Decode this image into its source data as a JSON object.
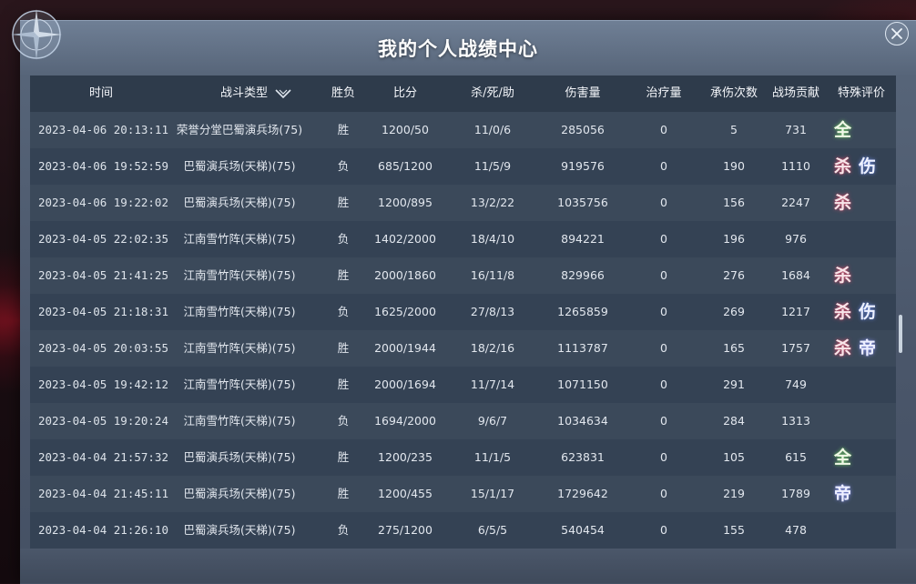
{
  "window": {
    "title": "我的个人战绩中心"
  },
  "table": {
    "headers": {
      "time": "时间",
      "type": "战斗类型",
      "result": "胜负",
      "score": "比分",
      "kda": "杀/死/助",
      "damage": "伤害量",
      "heal": "治疗量",
      "taken": "承伤次数",
      "contrib": "战场贡献",
      "eval": "特殊评价"
    },
    "rows": [
      {
        "time": "2023-04-06 20:13:11",
        "type": "荣誉分堂巴蜀演兵场(75)",
        "result": "胜",
        "score": "1200/50",
        "kda": "11/0/6",
        "damage": "285056",
        "heal": "0",
        "taken": "5",
        "contrib": "731",
        "badges": [
          "全"
        ]
      },
      {
        "time": "2023-04-06 19:52:59",
        "type": "巴蜀演兵场(天梯)(75)",
        "result": "负",
        "score": "685/1200",
        "kda": "11/5/9",
        "damage": "919576",
        "heal": "0",
        "taken": "190",
        "contrib": "1110",
        "badges": [
          "杀",
          "伤"
        ]
      },
      {
        "time": "2023-04-06 19:22:02",
        "type": "巴蜀演兵场(天梯)(75)",
        "result": "胜",
        "score": "1200/895",
        "kda": "13/2/22",
        "damage": "1035756",
        "heal": "0",
        "taken": "156",
        "contrib": "2247",
        "badges": [
          "杀"
        ]
      },
      {
        "time": "2023-04-05 22:02:35",
        "type": "江南雪竹阵(天梯)(75)",
        "result": "负",
        "score": "1402/2000",
        "kda": "18/4/10",
        "damage": "894221",
        "heal": "0",
        "taken": "196",
        "contrib": "976",
        "badges": []
      },
      {
        "time": "2023-04-05 21:41:25",
        "type": "江南雪竹阵(天梯)(75)",
        "result": "胜",
        "score": "2000/1860",
        "kda": "16/11/8",
        "damage": "829966",
        "heal": "0",
        "taken": "276",
        "contrib": "1684",
        "badges": [
          "杀"
        ]
      },
      {
        "time": "2023-04-05 21:18:31",
        "type": "江南雪竹阵(天梯)(75)",
        "result": "负",
        "score": "1625/2000",
        "kda": "27/8/13",
        "damage": "1265859",
        "heal": "0",
        "taken": "269",
        "contrib": "1217",
        "badges": [
          "杀",
          "伤"
        ]
      },
      {
        "time": "2023-04-05 20:03:55",
        "type": "江南雪竹阵(天梯)(75)",
        "result": "胜",
        "score": "2000/1944",
        "kda": "18/2/16",
        "damage": "1113787",
        "heal": "0",
        "taken": "165",
        "contrib": "1757",
        "badges": [
          "杀",
          "帝"
        ]
      },
      {
        "time": "2023-04-05 19:42:12",
        "type": "江南雪竹阵(天梯)(75)",
        "result": "胜",
        "score": "2000/1694",
        "kda": "11/7/14",
        "damage": "1071150",
        "heal": "0",
        "taken": "291",
        "contrib": "749",
        "badges": []
      },
      {
        "time": "2023-04-05 19:20:24",
        "type": "江南雪竹阵(天梯)(75)",
        "result": "负",
        "score": "1694/2000",
        "kda": "9/6/7",
        "damage": "1034634",
        "heal": "0",
        "taken": "284",
        "contrib": "1313",
        "badges": []
      },
      {
        "time": "2023-04-04 21:57:32",
        "type": "巴蜀演兵场(天梯)(75)",
        "result": "胜",
        "score": "1200/235",
        "kda": "11/1/5",
        "damage": "623831",
        "heal": "0",
        "taken": "105",
        "contrib": "615",
        "badges": [
          "全"
        ]
      },
      {
        "time": "2023-04-04 21:45:11",
        "type": "巴蜀演兵场(天梯)(75)",
        "result": "胜",
        "score": "1200/455",
        "kda": "15/1/17",
        "damage": "1729642",
        "heal": "0",
        "taken": "219",
        "contrib": "1789",
        "badges": [
          "帝"
        ]
      },
      {
        "time": "2023-04-04 21:26:10",
        "type": "巴蜀演兵场(天梯)(75)",
        "result": "负",
        "score": "275/1200",
        "kda": "6/5/5",
        "damage": "540454",
        "heal": "0",
        "taken": "155",
        "contrib": "478",
        "badges": []
      }
    ]
  },
  "icons": {
    "close": "close-icon",
    "sort": "chevron-down-icon",
    "emblem": "compass-emblem-icon"
  },
  "colors": {
    "panel": "#566478",
    "table_bg": "#324052",
    "row_odd": "#3b495a",
    "row_even": "#344254",
    "header_bg": "#2e3b4b",
    "kill_glow": "#e6506e",
    "damage_glow": "#6e8ce6",
    "all_glow": "#78d26e",
    "emperor_glow": "#8c96f0"
  }
}
